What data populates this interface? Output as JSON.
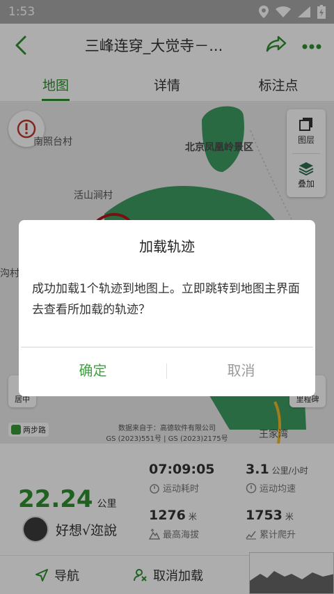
{
  "status_bar": {
    "time": "1:53"
  },
  "header": {
    "title": "三峰连穿_大觉寺－..."
  },
  "tabs": [
    {
      "label": "地图",
      "active": true
    },
    {
      "label": "详情",
      "active": false
    },
    {
      "label": "标注点",
      "active": false
    }
  ],
  "map": {
    "labels": {
      "nanzhaotai": "南照台村",
      "fenghuangling": "北京凤凰岭景区",
      "huoshandong": "活山涧村",
      "wangjiawan": "王家湾",
      "gou": "沟村"
    },
    "controls": {
      "layers": "图层",
      "overlay": "叠加"
    },
    "side_buttons": {
      "center": "居中",
      "milestone": "里程碑"
    },
    "walk_badge": "两步路",
    "credits": {
      "line1": "数据来自于：高德软件有限公司",
      "line2": "GS (2023)551号 | GS (2023)2175号"
    }
  },
  "stats": {
    "distance": {
      "value": "22.24",
      "unit": "公里"
    },
    "duration": {
      "value": "07:09:05",
      "label": "运动耗时"
    },
    "speed": {
      "value": "3.1",
      "unit": "公里/小时",
      "label": "运动均速"
    },
    "altitude": {
      "value": "1276",
      "unit": "米",
      "label": "最高海拔"
    },
    "climb": {
      "value": "1753",
      "unit": "米",
      "label": "累计爬升"
    }
  },
  "user": {
    "name": "好想√迩說"
  },
  "bottom_bar": {
    "navigate": "导航",
    "unload": "取消加载"
  },
  "dialog": {
    "title": "加载轨迹",
    "message": "成功加载1个轨迹到地图上。立即跳转到地图主界面去查看所加载的轨迹？",
    "confirm": "确定",
    "cancel": "取消"
  },
  "colors": {
    "accent": "#2f8f2f",
    "dialog_confirm": "#3aa63a",
    "map_green": "#3f9d63"
  }
}
